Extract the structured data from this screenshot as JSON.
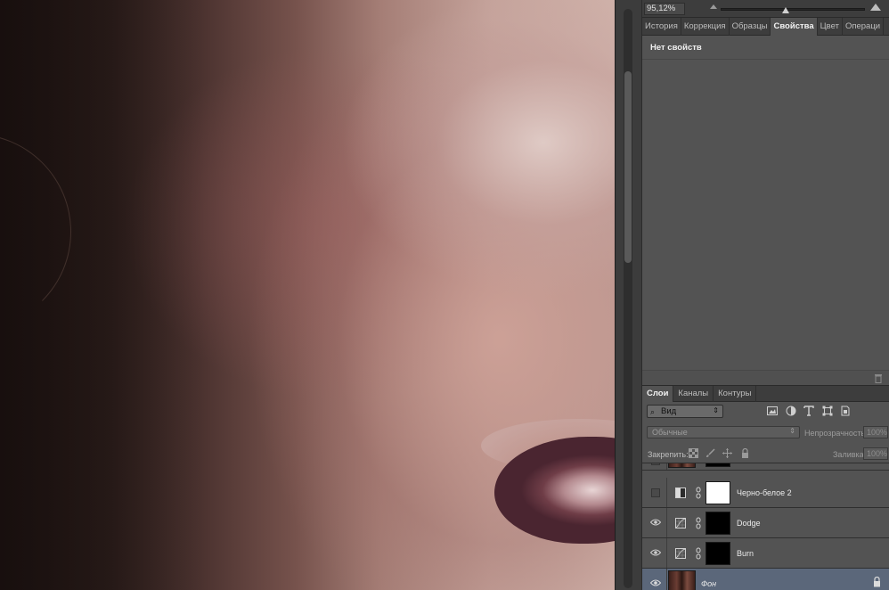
{
  "navigator": {
    "zoom": "95,12%",
    "zoom_slider_fraction": 0.45
  },
  "properties_tabs": [
    {
      "label": "История",
      "active": false
    },
    {
      "label": "Коррекция",
      "active": false
    },
    {
      "label": "Образцы",
      "active": false
    },
    {
      "label": "Свойства",
      "active": true
    },
    {
      "label": "Цвет",
      "active": false
    },
    {
      "label": "Операци",
      "active": false
    }
  ],
  "properties": {
    "empty_text": "Нет свойств"
  },
  "layers_tabs": [
    {
      "label": "Слои",
      "active": true
    },
    {
      "label": "Каналы",
      "active": false
    },
    {
      "label": "Контуры",
      "active": false
    }
  ],
  "layers_panel": {
    "filter_label": "Вид",
    "blend_mode": "Обычные",
    "opacity_label": "Непрозрачность:",
    "opacity_value": "100%",
    "lock_label": "Закрепить:",
    "fill_label": "Заливка:",
    "fill_value": "100%"
  },
  "layers": [
    {
      "name": "Черно-белое 2",
      "visible": false,
      "type": "black-white-adjustment",
      "mask": "white",
      "selected": false
    },
    {
      "name": "Dodge",
      "visible": true,
      "type": "curves-adjustment",
      "mask": "black",
      "selected": false
    },
    {
      "name": "Burn",
      "visible": true,
      "type": "curves-adjustment",
      "mask": "black",
      "selected": false
    },
    {
      "name": "Фон",
      "visible": true,
      "type": "background",
      "locked": true,
      "selected": true
    }
  ],
  "colors": {
    "panel_bg": "#535353",
    "tab_bg": "#3d3d3d",
    "selected_layer": "#5b677a"
  }
}
